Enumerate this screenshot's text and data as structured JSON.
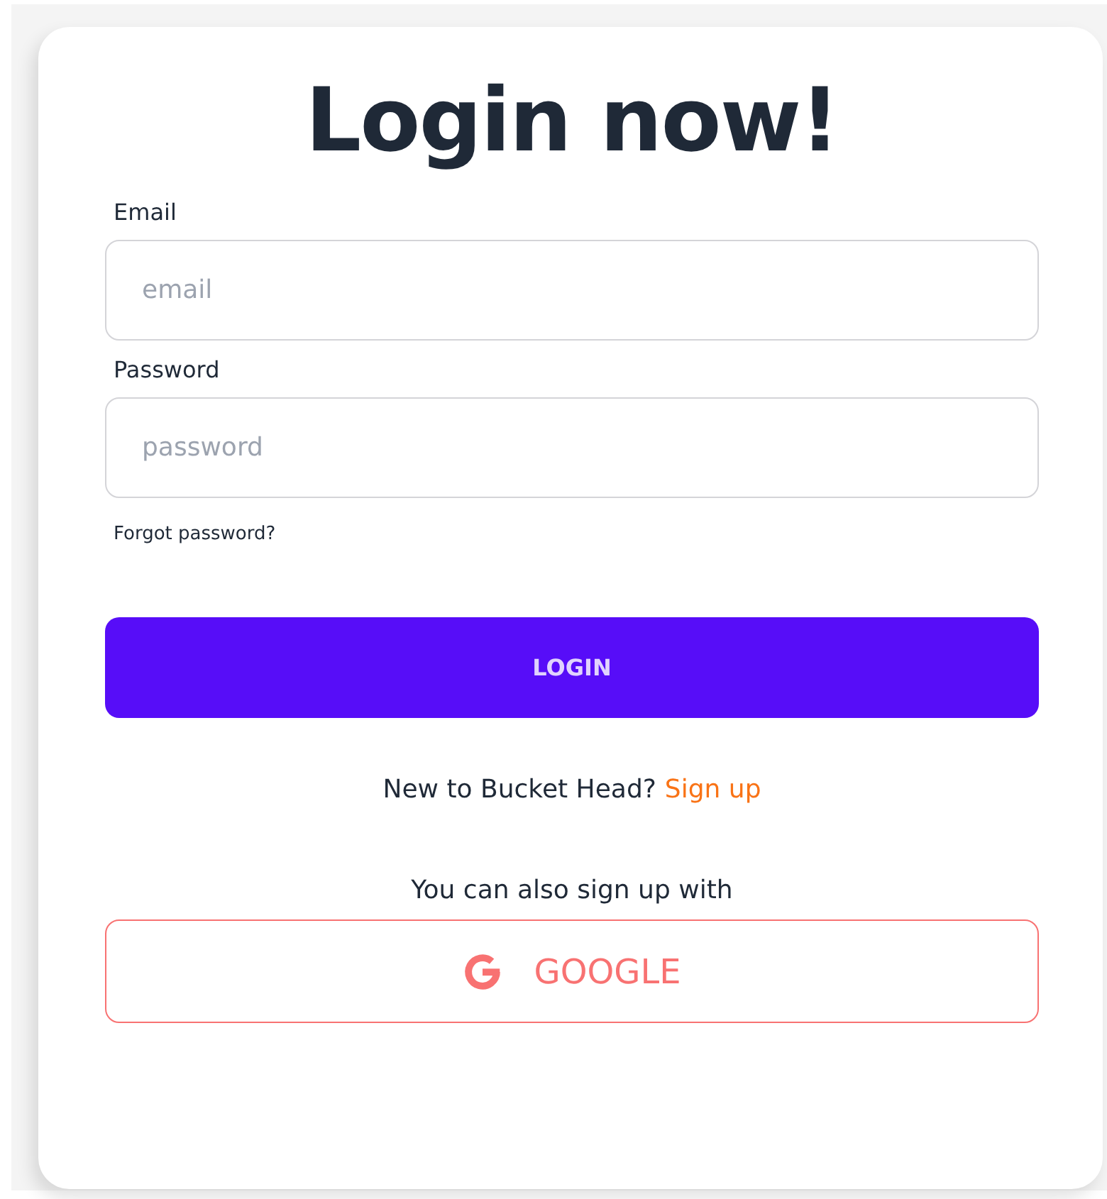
{
  "title": "Login now!",
  "fields": [
    {
      "label": "Email",
      "placeholder": "email"
    },
    {
      "label": "Password",
      "placeholder": "password"
    }
  ],
  "forgot_link": "Forgot password?",
  "login_button": "LOGIN",
  "signup_prompt": {
    "text": "New to Bucket Head?",
    "link": "Sign up"
  },
  "alt_signup_text": "You can also sign up with",
  "google_button": "GOOGLE"
}
